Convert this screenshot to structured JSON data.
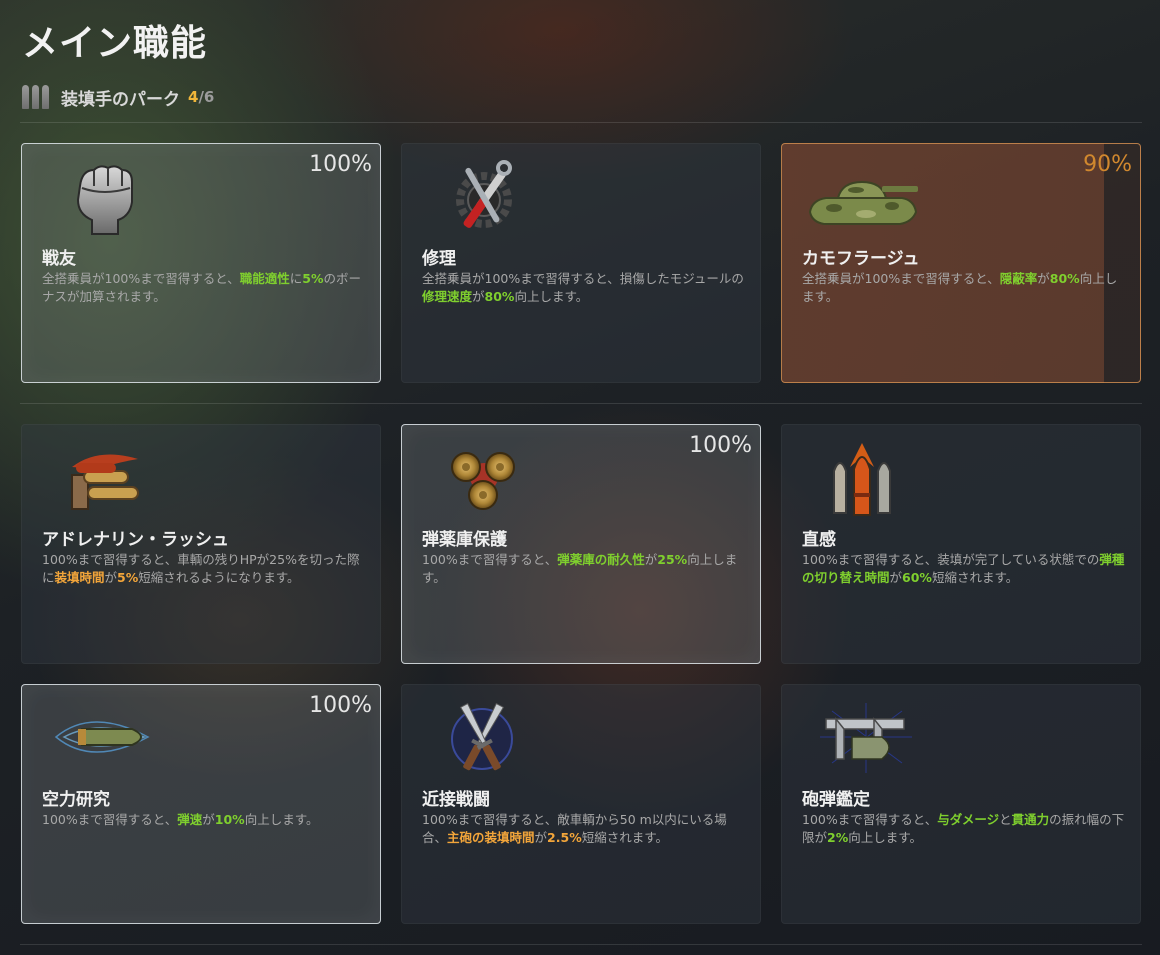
{
  "title": "メイン職能",
  "subtitle": {
    "label": "装填手のパーク",
    "current": "4",
    "total": "/6"
  },
  "cards": [
    {
      "name": "戦友",
      "percent": "100%",
      "icon": "fist-icon",
      "state": "learned",
      "desc": [
        {
          "t": "全搭乗員が100%まで習得すると、"
        },
        {
          "t": "職能適性",
          "c": "g"
        },
        {
          "t": "に"
        },
        {
          "t": "5%",
          "c": "g"
        },
        {
          "t": "のボーナスが加算されます。"
        }
      ]
    },
    {
      "name": "修理",
      "percent": "",
      "icon": "repair-tools-icon",
      "state": "none",
      "desc": [
        {
          "t": "全搭乗員が100%まで習得すると、損傷したモジュールの"
        },
        {
          "t": "修理速度",
          "c": "g"
        },
        {
          "t": "が"
        },
        {
          "t": "80%",
          "c": "g"
        },
        {
          "t": "向上します。"
        }
      ]
    },
    {
      "name": "カモフラージュ",
      "percent": "90%",
      "icon": "camo-tank-icon",
      "state": "partial",
      "desc": [
        {
          "t": "全搭乗員が100%まで習得すると、"
        },
        {
          "t": "隠蔽率",
          "c": "g"
        },
        {
          "t": "が"
        },
        {
          "t": "80%",
          "c": "g"
        },
        {
          "t": "向上します。"
        }
      ]
    },
    {
      "name": "アドレナリン・ラッシュ",
      "percent": "",
      "icon": "adrenaline-shells-icon",
      "state": "none",
      "desc": [
        {
          "t": "100%まで習得すると、車輌の残りHPが25%を切った際に"
        },
        {
          "t": "装填時間",
          "c": "o"
        },
        {
          "t": "が"
        },
        {
          "t": "5%",
          "c": "o"
        },
        {
          "t": "短縮されるようになります。"
        }
      ]
    },
    {
      "name": "弾薬庫保護",
      "percent": "100%",
      "icon": "ammo-rack-icon",
      "state": "learned",
      "desc": [
        {
          "t": "100%まで習得すると、"
        },
        {
          "t": "弾薬庫の耐久性",
          "c": "g"
        },
        {
          "t": "が"
        },
        {
          "t": "25%",
          "c": "g"
        },
        {
          "t": "向上します。"
        }
      ]
    },
    {
      "name": "直感",
      "percent": "",
      "icon": "intuition-shells-icon",
      "state": "none",
      "desc": [
        {
          "t": "100%まで習得すると、装填が完了している状態での"
        },
        {
          "t": "弾種の切り替え時間",
          "c": "g"
        },
        {
          "t": "が"
        },
        {
          "t": "60%",
          "c": "g"
        },
        {
          "t": "短縮されます。"
        }
      ]
    },
    {
      "name": "空力研究",
      "percent": "100%",
      "icon": "aerodynamic-shell-icon",
      "state": "learned",
      "desc": [
        {
          "t": "100%まで習得すると、"
        },
        {
          "t": "弾速",
          "c": "g"
        },
        {
          "t": "が"
        },
        {
          "t": "10%",
          "c": "g"
        },
        {
          "t": "向上します。"
        }
      ]
    },
    {
      "name": "近接戦闘",
      "percent": "",
      "icon": "crossed-knives-icon",
      "state": "none",
      "desc": [
        {
          "t": "100%まで習得すると、敵車輌から50 m以内にいる場合、"
        },
        {
          "t": "主砲の装填時間",
          "c": "o"
        },
        {
          "t": "が"
        },
        {
          "t": "2.5%",
          "c": "o"
        },
        {
          "t": "短縮されます。"
        }
      ]
    },
    {
      "name": "砲弾鑑定",
      "percent": "",
      "icon": "caliper-shell-icon",
      "state": "none",
      "desc": [
        {
          "t": "100%まで習得すると、"
        },
        {
          "t": "与ダメージ",
          "c": "g"
        },
        {
          "t": "と"
        },
        {
          "t": "貫通力",
          "c": "g"
        },
        {
          "t": "の振れ幅の下限が"
        },
        {
          "t": "2%",
          "c": "g"
        },
        {
          "t": "向上します。"
        }
      ]
    }
  ]
}
